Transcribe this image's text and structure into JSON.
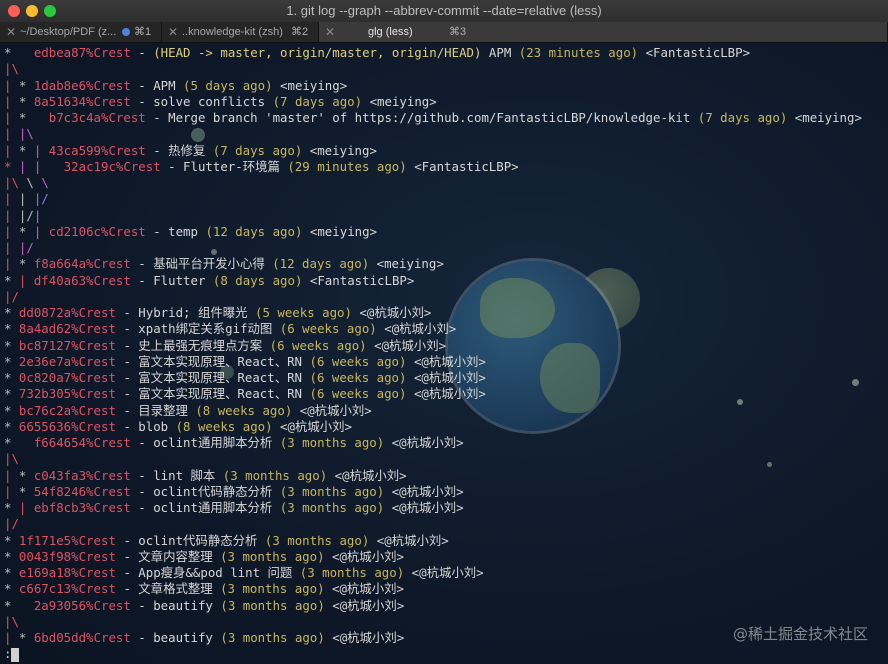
{
  "window": {
    "title": "1. git log --graph  --abbrev-commit --date=relative (less)"
  },
  "traffic_lights": {
    "close": "#fe5f57",
    "minimize": "#febc2e",
    "zoom": "#28c840"
  },
  "tabs": [
    {
      "label": "~/Desktop/PDF (z...",
      "shortcut": "⌘1",
      "close": "✕",
      "dot": true
    },
    {
      "label": "..knowledge-kit (zsh)",
      "shortcut": "⌘2",
      "close": "✕"
    },
    {
      "label": "glg (less)",
      "shortcut": "⌘3",
      "close": "✕",
      "active": true
    }
  ],
  "log_lines": [
    [
      [
        "g",
        "*   "
      ],
      [
        "s",
        "edbea87%Crest"
      ],
      [
        "w",
        " - "
      ],
      [
        "m",
        "(HEAD -> master, origin/master, origin/HEAD)"
      ],
      [
        "w",
        " APM "
      ],
      [
        "y",
        "(23 minutes ago)"
      ],
      [
        "w",
        " "
      ],
      [
        "p",
        "<FantasticLBP>"
      ]
    ],
    [
      [
        "r",
        "|\\"
      ]
    ],
    [
      [
        "r",
        "| "
      ],
      [
        "g",
        "* "
      ],
      [
        "s",
        "1dab8e6%Crest"
      ],
      [
        "w",
        " - APM "
      ],
      [
        "y",
        "(5 days ago)"
      ],
      [
        "w",
        " "
      ],
      [
        "p",
        "<meiying>"
      ]
    ],
    [
      [
        "r",
        "| "
      ],
      [
        "g",
        "* "
      ],
      [
        "s",
        "8a51634%Crest"
      ],
      [
        "w",
        " - solve conflicts "
      ],
      [
        "y",
        "(7 days ago)"
      ],
      [
        "w",
        " "
      ],
      [
        "p",
        "<meiying>"
      ]
    ],
    [
      [
        "r",
        "| "
      ],
      [
        "g",
        "*   "
      ],
      [
        "s",
        "b7c3c4a%Crest"
      ],
      [
        "w",
        " - Merge branch 'master' of https://github.com/FantasticLBP/knowledge-kit "
      ],
      [
        "y",
        "(7 days ago)"
      ],
      [
        "w",
        " "
      ],
      [
        "p",
        "<meiying>"
      ]
    ],
    [
      [
        "r",
        "| "
      ],
      [
        "mag",
        "|\\"
      ]
    ],
    [
      [
        "r",
        "| "
      ],
      [
        "g",
        "* "
      ],
      [
        "mag",
        "| "
      ],
      [
        "s",
        "43ca599%Crest"
      ],
      [
        "w",
        " - 热修复 "
      ],
      [
        "y",
        "(7 days ago)"
      ],
      [
        "w",
        " "
      ],
      [
        "p",
        "<meiying>"
      ]
    ],
    [
      [
        "r",
        "* "
      ],
      [
        "mag",
        "| "
      ],
      [
        "mag",
        "| "
      ],
      [
        "w",
        "  "
      ],
      [
        "s",
        "32ac19c%Crest"
      ],
      [
        "w",
        " - Flutter-环境篇 "
      ],
      [
        "y",
        "(29 minutes ago)"
      ],
      [
        "w",
        " "
      ],
      [
        "p",
        "<FantasticLBP>"
      ]
    ],
    [
      [
        "r",
        "|\\ "
      ],
      [
        "g",
        "\\ "
      ],
      [
        "mag",
        "\\"
      ]
    ],
    [
      [
        "r",
        "| "
      ],
      [
        "g",
        "| "
      ],
      [
        "bl",
        "|/"
      ]
    ],
    [
      [
        "r",
        "| "
      ],
      [
        "g",
        "|/"
      ],
      [
        "mag",
        "|"
      ]
    ],
    [
      [
        "r",
        "| "
      ],
      [
        "g",
        "* "
      ],
      [
        "mag",
        "| "
      ],
      [
        "s",
        "cd2106c%Crest"
      ],
      [
        "w",
        " - temp "
      ],
      [
        "y",
        "(12 days ago)"
      ],
      [
        "w",
        " "
      ],
      [
        "p",
        "<meiying>"
      ]
    ],
    [
      [
        "r",
        "| "
      ],
      [
        "mag",
        "|/"
      ]
    ],
    [
      [
        "r",
        "| "
      ],
      [
        "g",
        "* "
      ],
      [
        "s",
        "f8a664a%Crest"
      ],
      [
        "w",
        " - 基础平台开发小心得 "
      ],
      [
        "y",
        "(12 days ago)"
      ],
      [
        "w",
        " "
      ],
      [
        "p",
        "<meiying>"
      ]
    ],
    [
      [
        "g",
        "* "
      ],
      [
        "r",
        "| "
      ],
      [
        "s",
        "df40a63%Crest"
      ],
      [
        "w",
        " - Flutter "
      ],
      [
        "y",
        "(8 days ago)"
      ],
      [
        "w",
        " "
      ],
      [
        "p",
        "<FantasticLBP>"
      ]
    ],
    [
      [
        "r",
        "|/"
      ]
    ],
    [
      [
        "g",
        "* "
      ],
      [
        "s",
        "dd0872a%Crest"
      ],
      [
        "w",
        " - Hybrid; 组件曝光 "
      ],
      [
        "y",
        "(5 weeks ago)"
      ],
      [
        "w",
        " "
      ],
      [
        "p",
        "<@杭城小刘>"
      ]
    ],
    [
      [
        "g",
        "* "
      ],
      [
        "s",
        "8a4ad62%Crest"
      ],
      [
        "w",
        " - xpath绑定关系gif动图 "
      ],
      [
        "y",
        "(6 weeks ago)"
      ],
      [
        "w",
        " "
      ],
      [
        "p",
        "<@杭城小刘>"
      ]
    ],
    [
      [
        "g",
        "* "
      ],
      [
        "s",
        "bc87127%Crest"
      ],
      [
        "w",
        " - 史上最强无痕埋点方案 "
      ],
      [
        "y",
        "(6 weeks ago)"
      ],
      [
        "w",
        " "
      ],
      [
        "p",
        "<@杭城小刘>"
      ]
    ],
    [
      [
        "g",
        "* "
      ],
      [
        "s",
        "2e36e7a%Crest"
      ],
      [
        "w",
        " - 富文本实现原理、React、RN "
      ],
      [
        "y",
        "(6 weeks ago)"
      ],
      [
        "w",
        " "
      ],
      [
        "p",
        "<@杭城小刘>"
      ]
    ],
    [
      [
        "g",
        "* "
      ],
      [
        "s",
        "0c820a7%Crest"
      ],
      [
        "w",
        " - 富文本实现原理、React、RN "
      ],
      [
        "y",
        "(6 weeks ago)"
      ],
      [
        "w",
        " "
      ],
      [
        "p",
        "<@杭城小刘>"
      ]
    ],
    [
      [
        "g",
        "* "
      ],
      [
        "s",
        "732b305%Crest"
      ],
      [
        "w",
        " - 富文本实现原理、React、RN "
      ],
      [
        "y",
        "(6 weeks ago)"
      ],
      [
        "w",
        " "
      ],
      [
        "p",
        "<@杭城小刘>"
      ]
    ],
    [
      [
        "g",
        "* "
      ],
      [
        "s",
        "bc76c2a%Crest"
      ],
      [
        "w",
        " - 目录整理 "
      ],
      [
        "y",
        "(8 weeks ago)"
      ],
      [
        "w",
        " "
      ],
      [
        "p",
        "<@杭城小刘>"
      ]
    ],
    [
      [
        "g",
        "* "
      ],
      [
        "s",
        "6655636%Crest"
      ],
      [
        "w",
        " - blob "
      ],
      [
        "y",
        "(8 weeks ago)"
      ],
      [
        "w",
        " "
      ],
      [
        "p",
        "<@杭城小刘>"
      ]
    ],
    [
      [
        "g",
        "*   "
      ],
      [
        "s",
        "f664654%Crest"
      ],
      [
        "w",
        " - oclint通用脚本分析 "
      ],
      [
        "y",
        "(3 months ago)"
      ],
      [
        "w",
        " "
      ],
      [
        "p",
        "<@杭城小刘>"
      ]
    ],
    [
      [
        "r",
        "|\\"
      ]
    ],
    [
      [
        "r",
        "| "
      ],
      [
        "g",
        "* "
      ],
      [
        "s",
        "c043fa3%Crest"
      ],
      [
        "w",
        " - lint 脚本 "
      ],
      [
        "y",
        "(3 months ago)"
      ],
      [
        "w",
        " "
      ],
      [
        "p",
        "<@杭城小刘>"
      ]
    ],
    [
      [
        "r",
        "| "
      ],
      [
        "g",
        "* "
      ],
      [
        "s",
        "54f8246%Crest"
      ],
      [
        "w",
        " - oclint代码静态分析 "
      ],
      [
        "y",
        "(3 months ago)"
      ],
      [
        "w",
        " "
      ],
      [
        "p",
        "<@杭城小刘>"
      ]
    ],
    [
      [
        "g",
        "* "
      ],
      [
        "r",
        "| "
      ],
      [
        "s",
        "ebf8cb3%Crest"
      ],
      [
        "w",
        " - oclint通用脚本分析 "
      ],
      [
        "y",
        "(3 months ago)"
      ],
      [
        "w",
        " "
      ],
      [
        "p",
        "<@杭城小刘>"
      ]
    ],
    [
      [
        "r",
        "|/"
      ]
    ],
    [
      [
        "g",
        "* "
      ],
      [
        "s",
        "1f171e5%Crest"
      ],
      [
        "w",
        " - oclint代码静态分析 "
      ],
      [
        "y",
        "(3 months ago)"
      ],
      [
        "w",
        " "
      ],
      [
        "p",
        "<@杭城小刘>"
      ]
    ],
    [
      [
        "g",
        "* "
      ],
      [
        "s",
        "0043f98%Crest"
      ],
      [
        "w",
        " - 文章内容整理 "
      ],
      [
        "y",
        "(3 months ago)"
      ],
      [
        "w",
        " "
      ],
      [
        "p",
        "<@杭城小刘>"
      ]
    ],
    [
      [
        "g",
        "* "
      ],
      [
        "s",
        "e169a18%Crest"
      ],
      [
        "w",
        " - App瘦身&&pod lint 问题 "
      ],
      [
        "y",
        "(3 months ago)"
      ],
      [
        "w",
        " "
      ],
      [
        "p",
        "<@杭城小刘>"
      ]
    ],
    [
      [
        "g",
        "* "
      ],
      [
        "s",
        "c667c13%Crest"
      ],
      [
        "w",
        " - 文章格式整理 "
      ],
      [
        "y",
        "(3 months ago)"
      ],
      [
        "w",
        " "
      ],
      [
        "p",
        "<@杭城小刘>"
      ]
    ],
    [
      [
        "g",
        "*   "
      ],
      [
        "s",
        "2a93056%Crest"
      ],
      [
        "w",
        " - beautify "
      ],
      [
        "y",
        "(3 months ago)"
      ],
      [
        "w",
        " "
      ],
      [
        "p",
        "<@杭城小刘>"
      ]
    ],
    [
      [
        "r",
        "|\\"
      ]
    ],
    [
      [
        "r",
        "| "
      ],
      [
        "g",
        "* "
      ],
      [
        "s",
        "6bd05dd%Crest"
      ],
      [
        "w",
        " - beautify "
      ],
      [
        "y",
        "(3 months ago)"
      ],
      [
        "w",
        " "
      ],
      [
        "p",
        "<@杭城小刘>"
      ]
    ]
  ],
  "prompt": ":",
  "watermark": "@稀土掘金技术社区"
}
